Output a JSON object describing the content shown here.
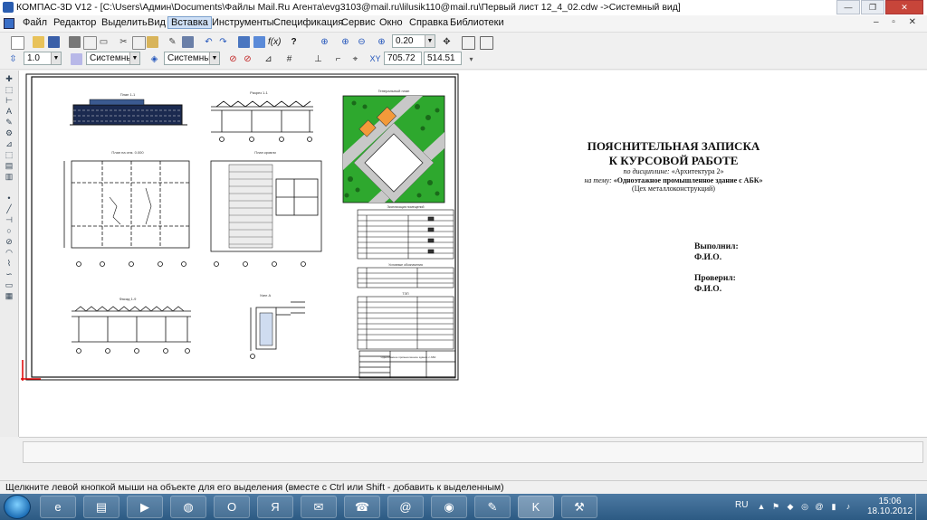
{
  "window": {
    "title": "КОМПАС-3D V12 - [C:\\Users\\Админ\\Documents\\Файлы Mail.Ru Агента\\evg3103@mail.ru\\lilusik110@mail.ru\\Первый лист 12_4_02.cdw ->Системный вид]",
    "minimize_glyph": "—",
    "maximize_glyph": "❐",
    "close_glyph": "✕"
  },
  "menu": {
    "items": [
      "Файл",
      "Редактор",
      "Выделить",
      "Вид",
      "Вставка",
      "Инструменты",
      "Спецификация",
      "Сервис",
      "Окно",
      "Справка",
      "Библиотеки"
    ],
    "active": "Вставка",
    "mdi_controls": "– ▫ ✕"
  },
  "toolbar1": {
    "zoom_value": "0.20"
  },
  "toolbar2": {
    "step_value": "1.0",
    "style1": "Системный",
    "style2": "Системный",
    "coord_x": "705.72",
    "coord_y": "514.51"
  },
  "drawing": {
    "plan_title_top": "План 1-1",
    "section_title": "Разрез 1-1",
    "genplan_title": "Генеральный план",
    "facade_title": "Фасад 1-9",
    "detail_title": "Узел А",
    "floor_plan_title": "План на отм. 0.000",
    "roof_plan_title": "План кровли",
    "explication_title": "Экспликация помещений",
    "legend_title": "Условные обозначения",
    "tep_title": "ТЭП",
    "stamp_text": "Одноэтажное промышленное здание с АБК"
  },
  "note": {
    "title_line1": "ПОЯСНИТЕЛЬНАЯ ЗАПИСКА",
    "title_line2": "К КУРСОВОЙ РАБОТЕ",
    "discipline_label": "по дисциплине:",
    "discipline_value": "«Архитектура 2»",
    "topic_label": "на тему:",
    "topic_value": "«Одноэтажное промышленное здание с АБК»",
    "subtitle": "(Цех металлоконструкций)",
    "done_label": "Выполнил:",
    "done_name": "Ф.И.О.",
    "checked_label": "Проверил:",
    "checked_name": "Ф.И.О."
  },
  "status": {
    "hint": "Щелкните левой кнопкой мыши на объекте для его выделения (вместе с Ctrl или Shift - добавить к выделенным)"
  },
  "taskbar": {
    "language": "RU",
    "time": "15:06",
    "date": "18.10.2012",
    "apps": [
      "IE",
      "Проводник",
      "Медиаплеер",
      "Skype",
      "Opera",
      "Яндекс",
      "Outlook",
      "Контакты",
      "Mail.Ru Агент",
      "Firefox",
      "Редактор",
      "KOMPAS",
      "Инструменты"
    ],
    "app_glyphs": [
      "e",
      "▤",
      "▶",
      "◍",
      "O",
      "Я",
      "✉",
      "☎",
      "@",
      "◉",
      "✎",
      "K",
      "⚒"
    ]
  },
  "colors": {
    "accent": "#cfe0f6",
    "taskbar": "#3a6a95",
    "drawing_line": "#1a1a1a",
    "frame_red": "#d00000",
    "genplan_green": "#2ea82e",
    "genplan_orange": "#f39a3a",
    "road_gray": "#c8c8c8"
  }
}
